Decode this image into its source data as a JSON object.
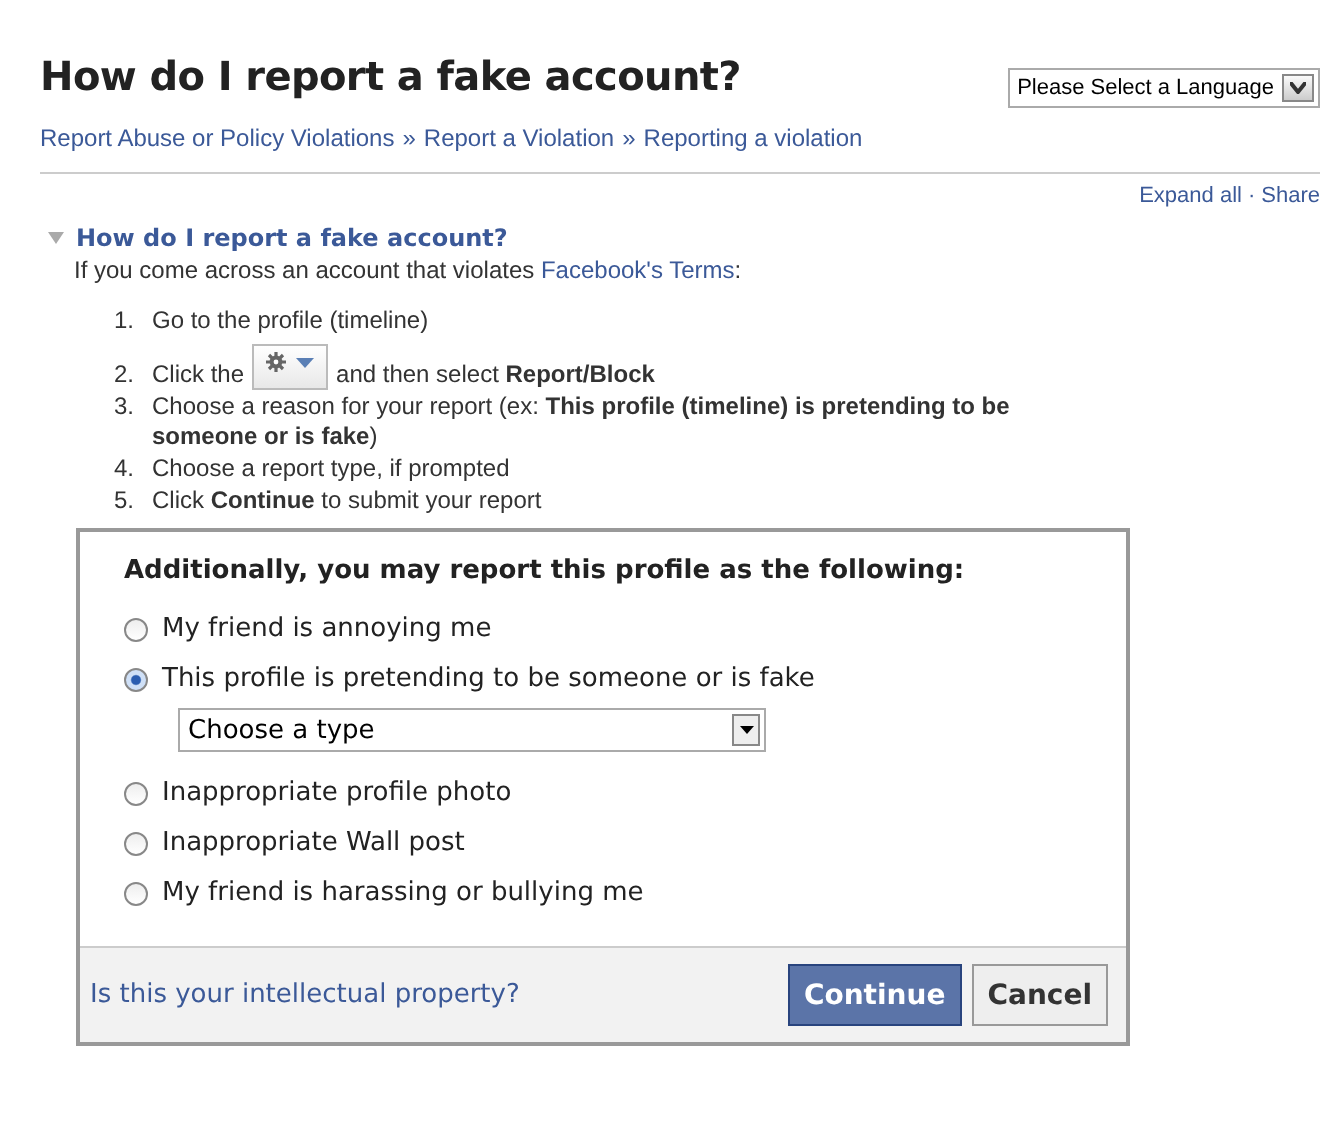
{
  "title": "How do I report a fake account?",
  "language_select": {
    "value": "Please Select a Language"
  },
  "breadcrumb": {
    "separator": "»",
    "items": [
      "Report Abuse or Policy Violations",
      "Report a Violation",
      "Reporting a violation"
    ]
  },
  "actions": {
    "separator": "·",
    "items": [
      "Expand all",
      "Share"
    ]
  },
  "section": {
    "title": "How do I report a fake account?",
    "expanded": true,
    "intro": {
      "before": "If you come across an account that violates ",
      "link": "Facebook's Terms",
      "after": ":"
    },
    "steps": [
      {
        "number": "1.",
        "kind": "text",
        "text": "Go to the profile (timeline)"
      },
      {
        "number": "2.",
        "kind": "button",
        "before": "Click the",
        "after": "and then select **Report/Block**"
      },
      {
        "number": "3.",
        "kind": "text",
        "text": "Choose a reason for your report (ex: **This profile (timeline) is pretending to be someone or is fake**)"
      },
      {
        "number": "4.",
        "kind": "text",
        "text": "Choose a report type, if prompted"
      },
      {
        "number": "5.",
        "kind": "text",
        "text": "Click **Continue** to submit your report"
      }
    ]
  },
  "dialog": {
    "heading": "Additionally, you may report this profile as the following:",
    "options": [
      {
        "label": "My friend is annoying me",
        "selected": false
      },
      {
        "label": "This profile is pretending to be someone or is fake",
        "selected": true,
        "dropdown": {
          "value": "Choose a type"
        }
      },
      {
        "label": "Inappropriate profile photo",
        "selected": false
      },
      {
        "label": "Inappropriate Wall post",
        "selected": false
      },
      {
        "label": "My friend is harassing or bullying me",
        "selected": false
      }
    ],
    "footer_link": "Is this your intellectual property?",
    "buttons": [
      {
        "label": "Continue",
        "kind": "primary"
      },
      {
        "label": "Cancel",
        "kind": "secondary"
      }
    ]
  }
}
